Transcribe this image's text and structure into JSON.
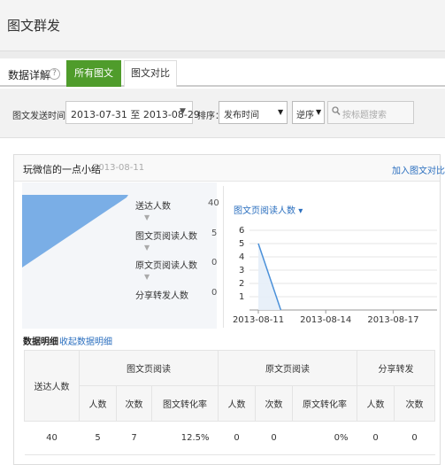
{
  "page": {
    "title": "图文群发"
  },
  "tabs": {
    "section_label": "数据详解",
    "help": "?",
    "items": [
      "所有图文",
      "图文对比"
    ]
  },
  "filters": {
    "date_label": "图文发送时间：",
    "date_range": "2013-07-31 至 2013-08-29",
    "sort_label": "排序：",
    "sort_field": "发布时间",
    "sort_order": "逆序",
    "search_placeholder": "按标题搜索"
  },
  "card": {
    "title": "玩微信的一点小结",
    "date": "2013-08-11",
    "add_compare": "加入图文对比"
  },
  "funnel": [
    {
      "label": "送达人数",
      "value": "40"
    },
    {
      "label": "图文页阅读人数",
      "value": "5"
    },
    {
      "label": "原文页阅读人数",
      "value": "0"
    },
    {
      "label": "分享转发人数",
      "value": "0"
    }
  ],
  "chart_data": {
    "type": "line",
    "title": "图文页阅读人数",
    "x": [
      "2013-08-11",
      "2013-08-12"
    ],
    "y": [
      5,
      0
    ],
    "xticks": [
      "2013-08-11",
      "2013-08-14",
      "2013-08-17"
    ],
    "yticks": [
      "1",
      "2",
      "3",
      "4",
      "5",
      "6"
    ],
    "ylim": [
      0,
      6
    ],
    "grid": true,
    "color": "#4a90d9"
  },
  "detail": {
    "title": "数据明细",
    "collapse_label": "收起数据明细",
    "groups": {
      "delivered": "送达人数",
      "article": "图文页阅读",
      "original": "原文页阅读",
      "share": "分享转发"
    },
    "subheaders": [
      "人数",
      "次数",
      "图文转化率",
      "人数",
      "次数",
      "原文转化率",
      "人数",
      "次数"
    ],
    "row": [
      "40",
      "5",
      "7",
      "12.5%",
      "0",
      "0",
      "0%",
      "0",
      "0"
    ]
  },
  "colors": {
    "accent_green": "#4f9c2b",
    "link_blue": "#2b6fbf",
    "funnel_blue": "#7aaee6"
  }
}
